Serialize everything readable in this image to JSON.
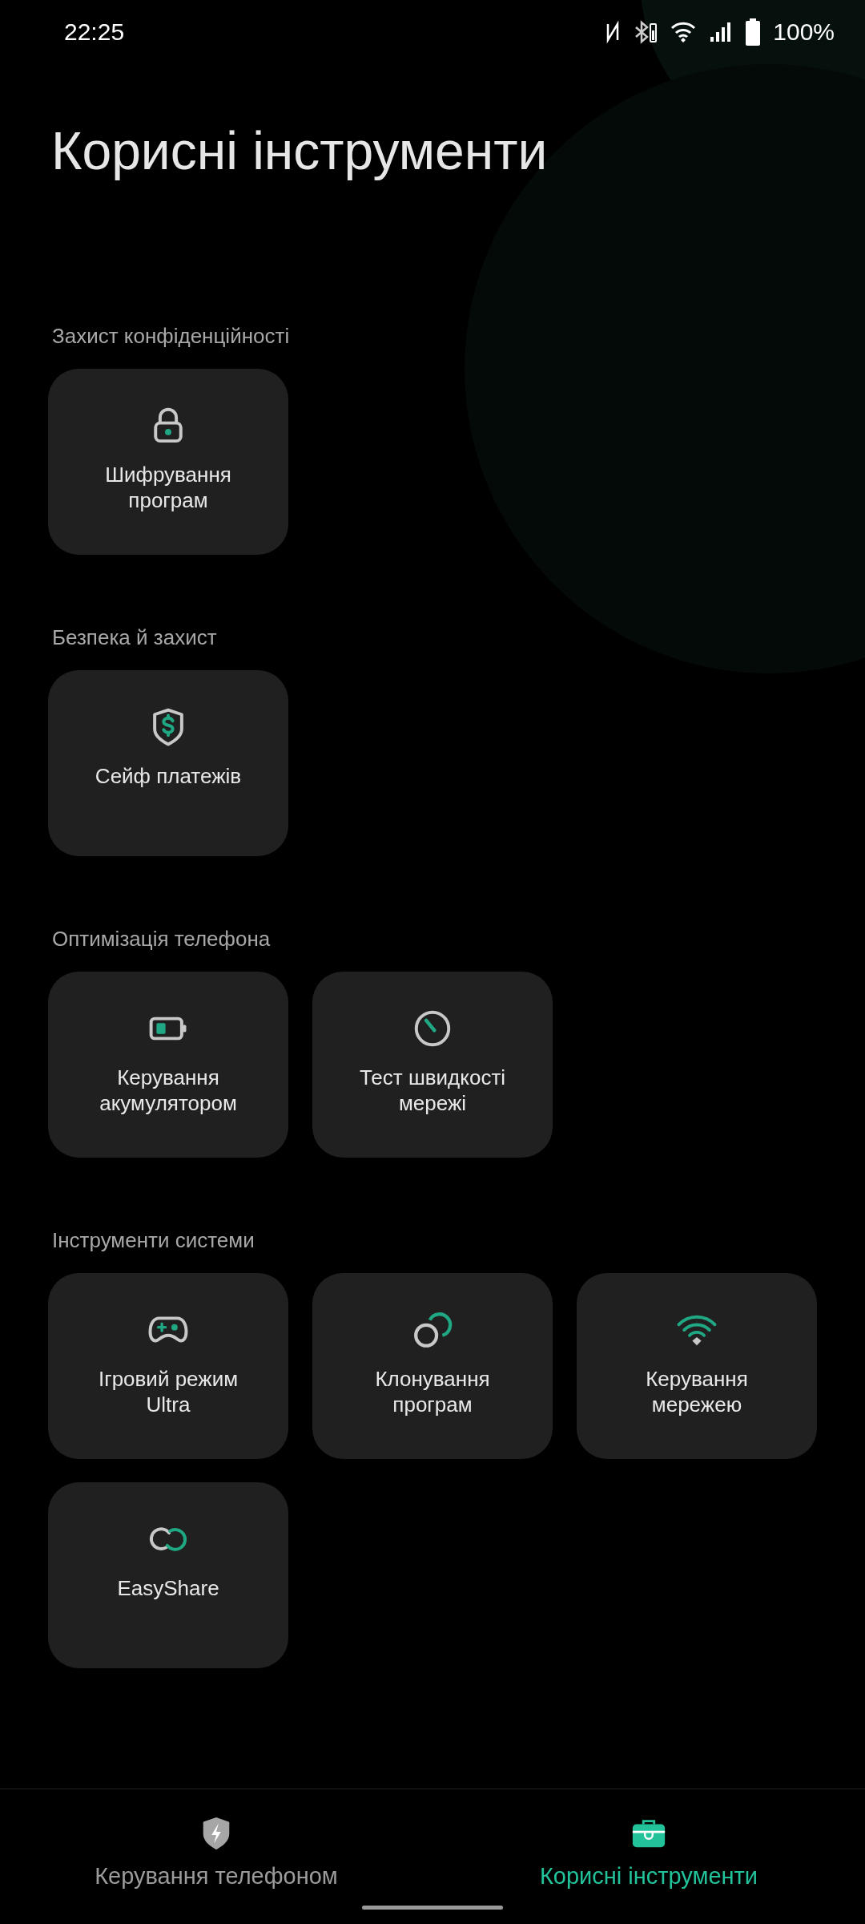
{
  "status_bar": {
    "time": "22:25",
    "battery": "100%"
  },
  "title": "Корисні інструменти",
  "sections": [
    {
      "heading": "Захист конфіденційності",
      "tiles": [
        {
          "kind": "lock",
          "label": "Шифрування програм"
        }
      ]
    },
    {
      "heading": "Безпека й захист",
      "tiles": [
        {
          "kind": "shield",
          "label": "Сейф платежів"
        }
      ]
    },
    {
      "heading": "Оптимізація телефона",
      "tiles": [
        {
          "kind": "battery",
          "label": "Керування акумулятором"
        },
        {
          "kind": "gauge",
          "label": "Тест швидкості мережі"
        }
      ]
    },
    {
      "heading": "Інструменти системи",
      "tiles": [
        {
          "kind": "gamepad",
          "label": "Ігровий режим Ultra"
        },
        {
          "kind": "clone",
          "label": "Клонування програм"
        },
        {
          "kind": "wifi",
          "label": "Керування мережею"
        },
        {
          "kind": "share",
          "label": "EasyShare"
        }
      ]
    }
  ],
  "bottom_nav": [
    {
      "kind": "phone",
      "label": "Керування телефоном",
      "selected": false
    },
    {
      "kind": "tools",
      "label": "Корисні інструменти",
      "selected": true
    }
  ]
}
